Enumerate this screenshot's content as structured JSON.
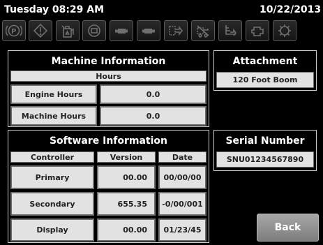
{
  "status": {
    "day_time": "Tuesday 08:29 AM",
    "date": "10/22/2013"
  },
  "icons": [
    "parking-brake-icon",
    "warning-icon",
    "fuel-icon",
    "engine-icon",
    "drive-left-icon",
    "drive-right-icon",
    "hydraulic-icon",
    "no-transport-icon",
    "boom-icon",
    "engine-alt-icon",
    "filter-icon"
  ],
  "machine": {
    "title": "Machine Information",
    "hours_header": "Hours",
    "rows": [
      {
        "label": "Engine Hours",
        "value": "0.0"
      },
      {
        "label": "Machine Hours",
        "value": "0.0"
      }
    ]
  },
  "attachment": {
    "title": "Attachment",
    "value": "120 Foot Boom"
  },
  "software": {
    "title": "Software Information",
    "headers": {
      "controller": "Controller",
      "version": "Version",
      "date": "Date"
    },
    "rows": [
      {
        "controller": "Primary",
        "version": "00.00",
        "date": "00/00/00"
      },
      {
        "controller": "Secondary",
        "version": "655.35",
        "date": "-0/00/001"
      },
      {
        "controller": "Display",
        "version": "00.00",
        "date": "01/23/45"
      }
    ]
  },
  "serial": {
    "title": "Serial Number",
    "value": "SNU01234567890"
  },
  "buttons": {
    "back": "Back"
  },
  "colors": {
    "background": "#000000",
    "cell": "#e2e2e2",
    "button": "#8f8f8f",
    "icon": "#6f6f6f"
  }
}
